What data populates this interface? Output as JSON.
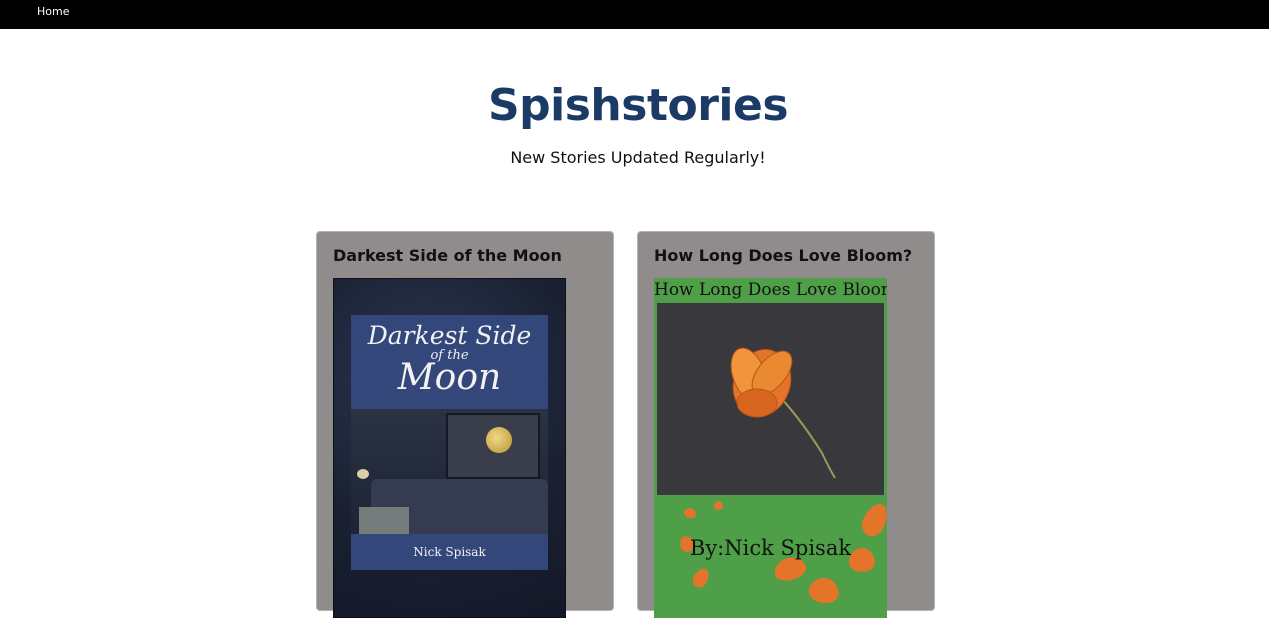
{
  "nav": {
    "home_label": "Home"
  },
  "header": {
    "title": "Spishstories",
    "tagline": "New Stories Updated Regularly!"
  },
  "stories": [
    {
      "title": "Darkest Side of the Moon",
      "cover": {
        "title_line1": "Darkest Side",
        "title_line2": "of the",
        "title_line3": "Moon",
        "author": "Nick Spisak"
      }
    },
    {
      "title": "How Long Does Love Bloom?",
      "cover": {
        "title": "How Long Does Love Bloom?",
        "author": "By:Nick Spisak"
      }
    }
  ],
  "colors": {
    "nav_bg": "#000000",
    "title": "#1b3a66",
    "card_bg": "#908c8c",
    "cover1_panel": "#33477a",
    "cover2_bg": "#4f9e48",
    "flower": "#e4742a"
  }
}
